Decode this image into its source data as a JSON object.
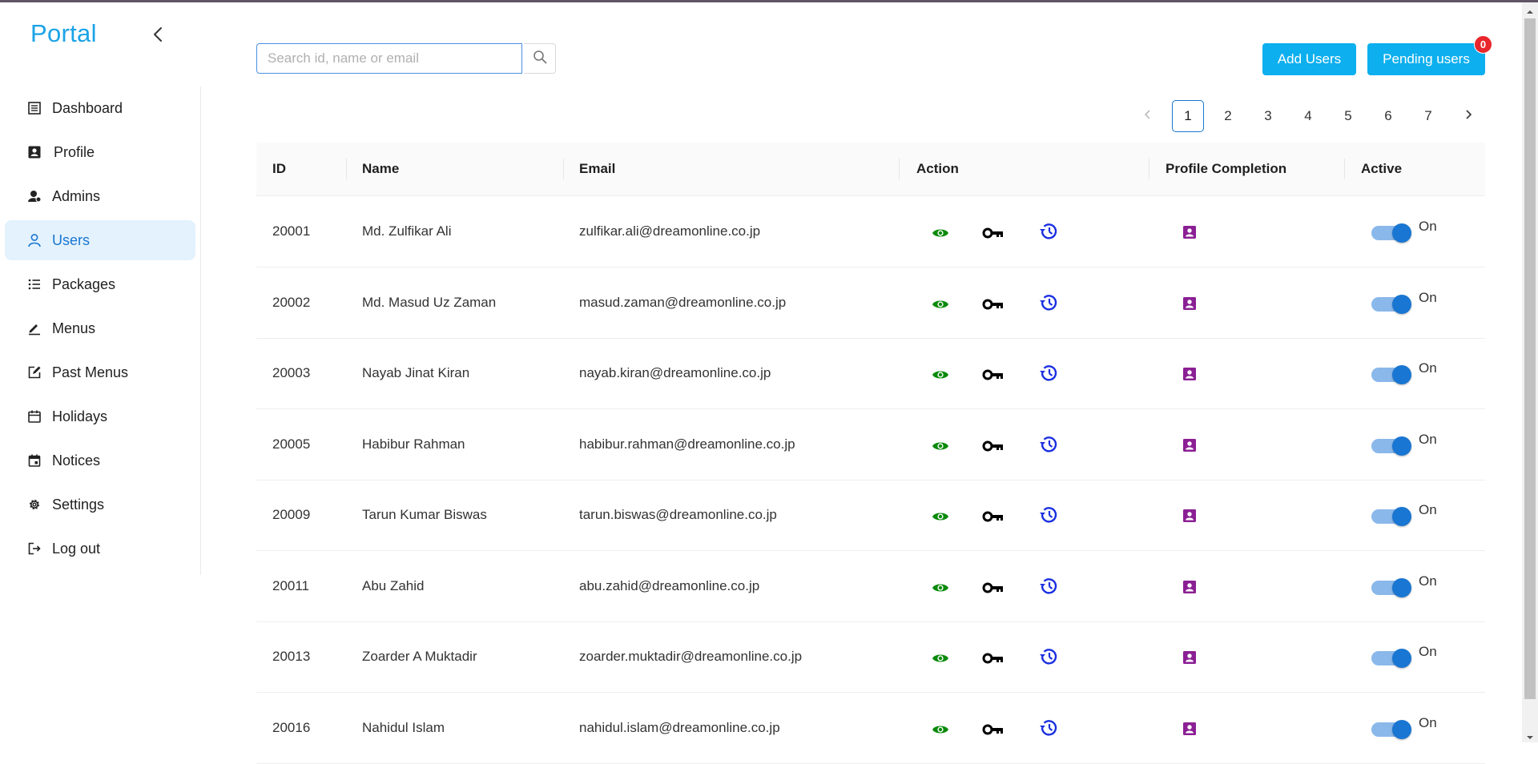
{
  "app": {
    "brand": "Portal"
  },
  "sidebar": {
    "items": [
      {
        "label": "Dashboard",
        "icon": "dashboard-icon",
        "active": false
      },
      {
        "label": "Profile",
        "icon": "profile-card-icon",
        "active": false
      },
      {
        "label": "Admins",
        "icon": "admin-icon",
        "active": false
      },
      {
        "label": "Users",
        "icon": "user-icon",
        "active": true
      },
      {
        "label": "Packages",
        "icon": "list-icon",
        "active": false
      },
      {
        "label": "Menus",
        "icon": "pen-icon",
        "active": false
      },
      {
        "label": "Past Menus",
        "icon": "edit-square-icon",
        "active": false
      },
      {
        "label": "Holidays",
        "icon": "calendar-icon",
        "active": false
      },
      {
        "label": "Notices",
        "icon": "calendar-event-icon",
        "active": false
      },
      {
        "label": "Settings",
        "icon": "gear-icon",
        "active": false
      },
      {
        "label": "Log out",
        "icon": "logout-icon",
        "active": false
      }
    ]
  },
  "search": {
    "placeholder": "Search id, name or email",
    "value": ""
  },
  "toolbar": {
    "add_users": "Add Users",
    "pending_users": "Pending users",
    "pending_count": "0"
  },
  "pagination": {
    "pages": [
      "1",
      "2",
      "3",
      "4",
      "5",
      "6",
      "7"
    ],
    "current": "1"
  },
  "table": {
    "headers": [
      "ID",
      "Name",
      "Email",
      "Action",
      "Profile Completion",
      "Active"
    ],
    "rows": [
      {
        "id": "20001",
        "name": "Md. Zulfikar Ali",
        "email": "zulfikar.ali@dreamonline.co.jp",
        "active": "On"
      },
      {
        "id": "20002",
        "name": "Md. Masud Uz Zaman",
        "email": "masud.zaman@dreamonline.co.jp",
        "active": "On"
      },
      {
        "id": "20003",
        "name": "Nayab Jinat Kiran",
        "email": "nayab.kiran@dreamonline.co.jp",
        "active": "On"
      },
      {
        "id": "20005",
        "name": "Habibur Rahman",
        "email": "habibur.rahman@dreamonline.co.jp",
        "active": "On"
      },
      {
        "id": "20009",
        "name": "Tarun Kumar Biswas",
        "email": "tarun.biswas@dreamonline.co.jp",
        "active": "On"
      },
      {
        "id": "20011",
        "name": "Abu Zahid",
        "email": "abu.zahid@dreamonline.co.jp",
        "active": "On"
      },
      {
        "id": "20013",
        "name": "Zoarder A Muktadir",
        "email": "zoarder.muktadir@dreamonline.co.jp",
        "active": "On"
      },
      {
        "id": "20016",
        "name": "Nahidul Islam",
        "email": "nahidul.islam@dreamonline.co.jp",
        "active": "On"
      }
    ]
  },
  "colors": {
    "brand": "#1aa3e6",
    "button": "#0dafee",
    "badge": "#e8262b",
    "view_icon": "#0a8a0a",
    "key_icon": "#000000",
    "history_icon": "#1a2fe0",
    "profile_icon": "#8b1f94",
    "toggle_on": "#1976d2"
  }
}
